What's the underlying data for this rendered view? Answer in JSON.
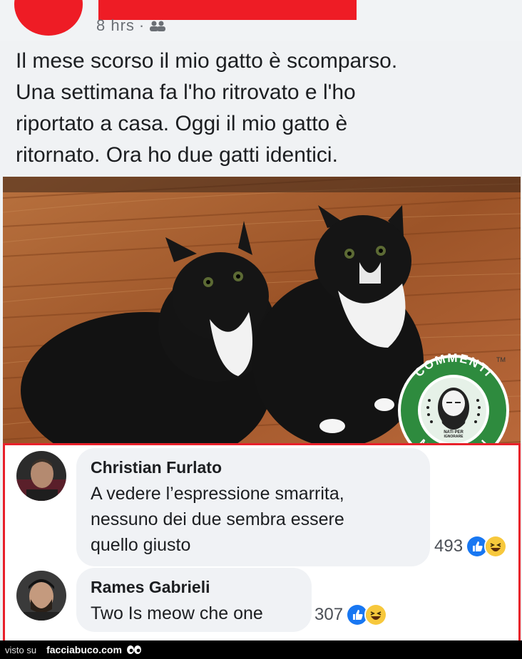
{
  "post": {
    "time": "8 hrs",
    "separator": "·",
    "audience_icon": "friends-icon",
    "text_lines": [
      "Il mese scorso il mio gatto è scomparso.",
      "Una settimana fa l'ho ritrovato e l'ho",
      "riportato a casa. Oggi il mio gatto è",
      "ritornato. Ora ho due gatti identici."
    ]
  },
  "photo": {
    "subject": "two black and white cats on a wooden floor"
  },
  "watermark_logo": {
    "top_text": "COMMENTI",
    "bottom_text": "MEMORABILI",
    "tagline": "NATI PER IGNORARE",
    "trademark": "TM",
    "color": "#2e8b3e"
  },
  "comments": [
    {
      "author": "Christian Furlato",
      "text_lines": [
        "A vedere l’espressione smarrita,",
        "nessuno dei due sembra essere",
        "quello giusto"
      ],
      "reaction_count": "493",
      "reactions": [
        "like-icon",
        "haha-icon"
      ]
    },
    {
      "author": "Rames Gabrieli",
      "text_lines": [
        "Two Is meow che one"
      ],
      "reaction_count": "307",
      "reactions": [
        "like-icon",
        "haha-icon"
      ]
    }
  ],
  "footer": {
    "visto_label": "visto su",
    "site": "facciabuco.com",
    "eyes_icon": "eyes-icon"
  },
  "colors": {
    "highlight_red": "#ee1c25",
    "comments_border": "#e8202a",
    "like_blue": "#1877f2",
    "haha_yellow": "#f7c83c"
  }
}
